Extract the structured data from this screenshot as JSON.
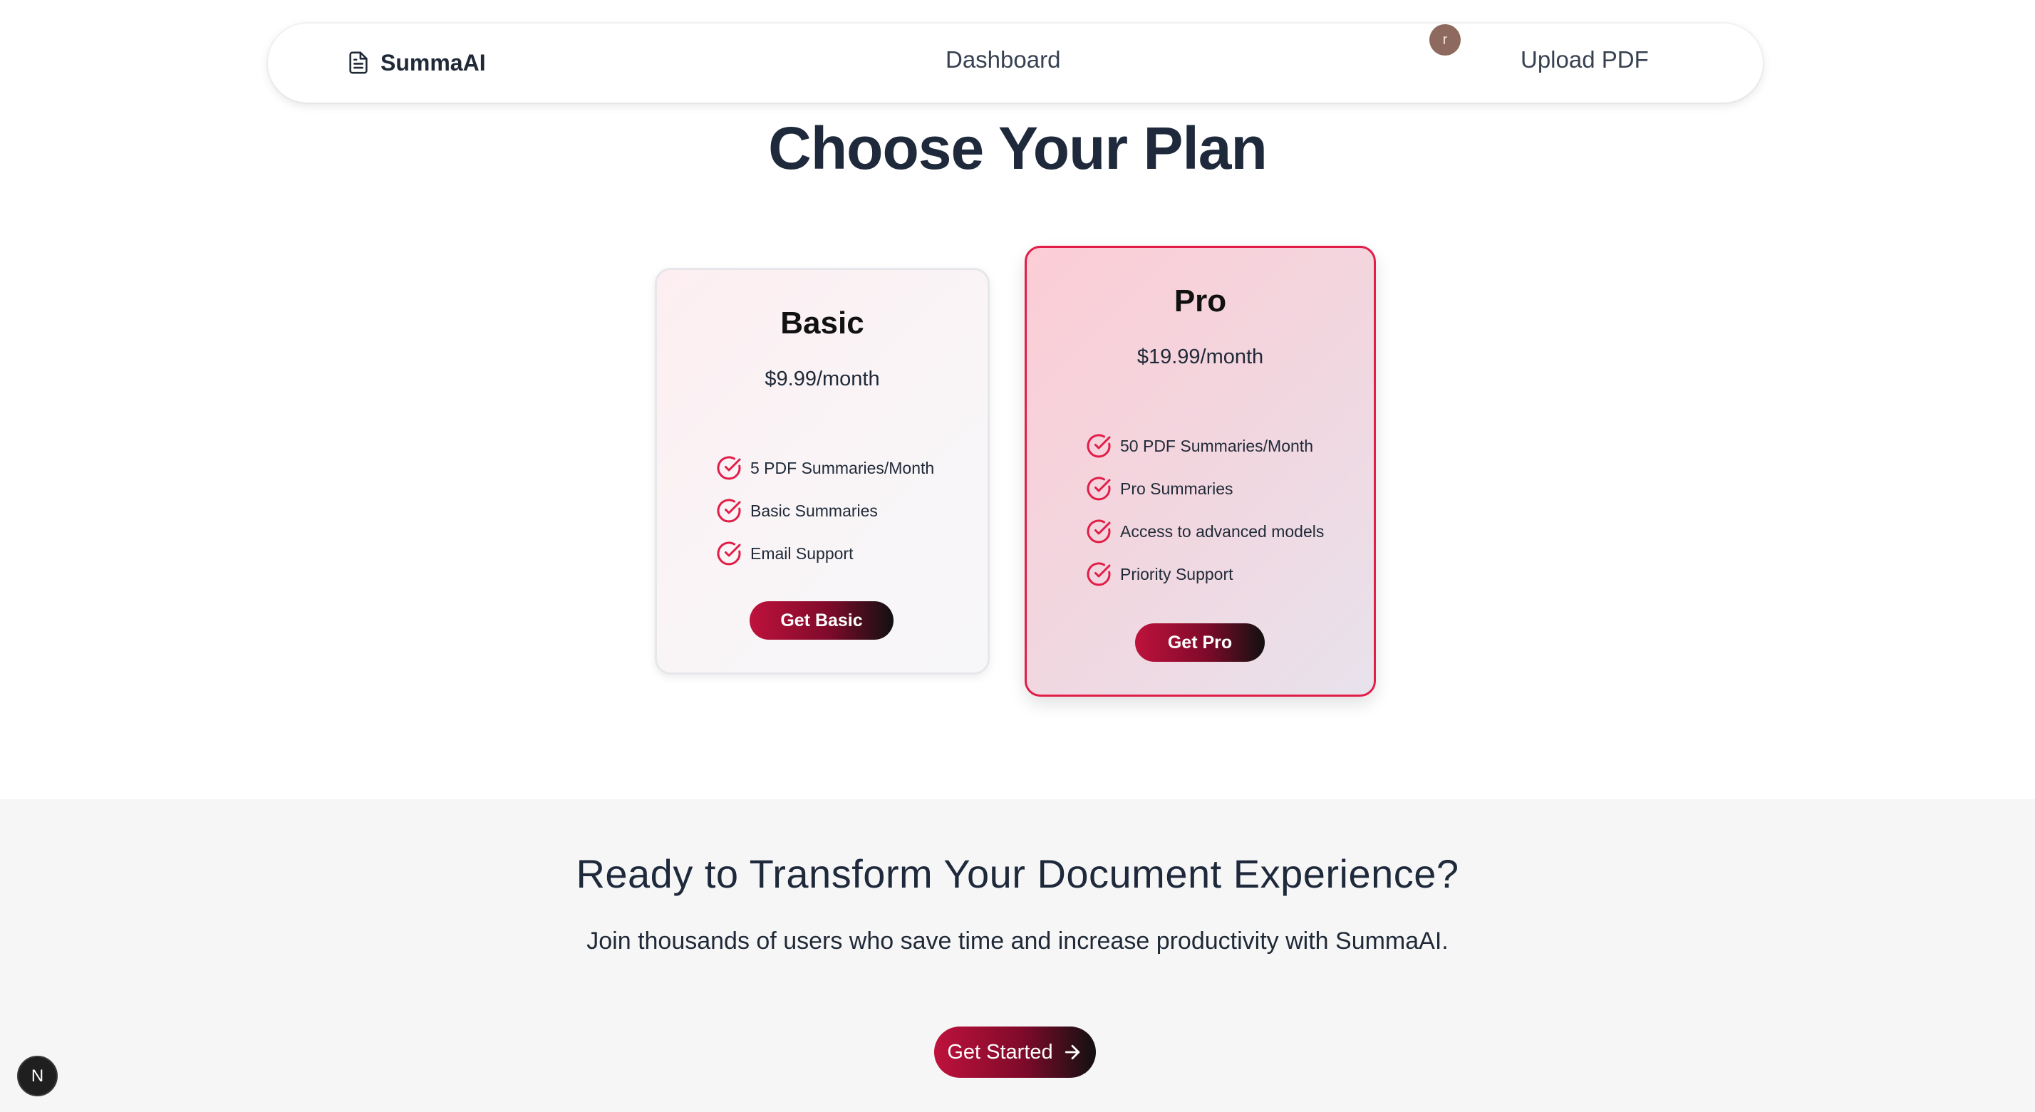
{
  "header": {
    "brand": "SummaAI",
    "brand_icon": "document-icon",
    "nav_dashboard": "Dashboard",
    "nav_upload": "Upload PDF",
    "avatar_initial": "r"
  },
  "pricing": {
    "title": "Choose Your Plan",
    "plans": [
      {
        "name": "Basic",
        "price": "$9.99/month",
        "features": [
          "5 PDF Summaries/Month",
          "Basic Summaries",
          "Email Support"
        ],
        "button": "Get Basic"
      },
      {
        "name": "Pro",
        "price": "$19.99/month",
        "features": [
          "50 PDF Summaries/Month",
          "Pro Summaries",
          "Access to advanced models",
          "Priority Support"
        ],
        "button": "Get Pro"
      }
    ]
  },
  "cta": {
    "title": "Ready to Transform Your Document Experience?",
    "subtitle": "Join thousands of users who save time and increase productivity with SummaAI.",
    "button": "Get Started",
    "button_icon": "arrow-right-icon"
  },
  "dev_badge": {
    "label": "N"
  },
  "colors": {
    "accent": "#e11d48",
    "button_start": "#be123c",
    "button_end": "#111111",
    "heading": "#1e293b",
    "cta_background": "#f6f6f6"
  }
}
